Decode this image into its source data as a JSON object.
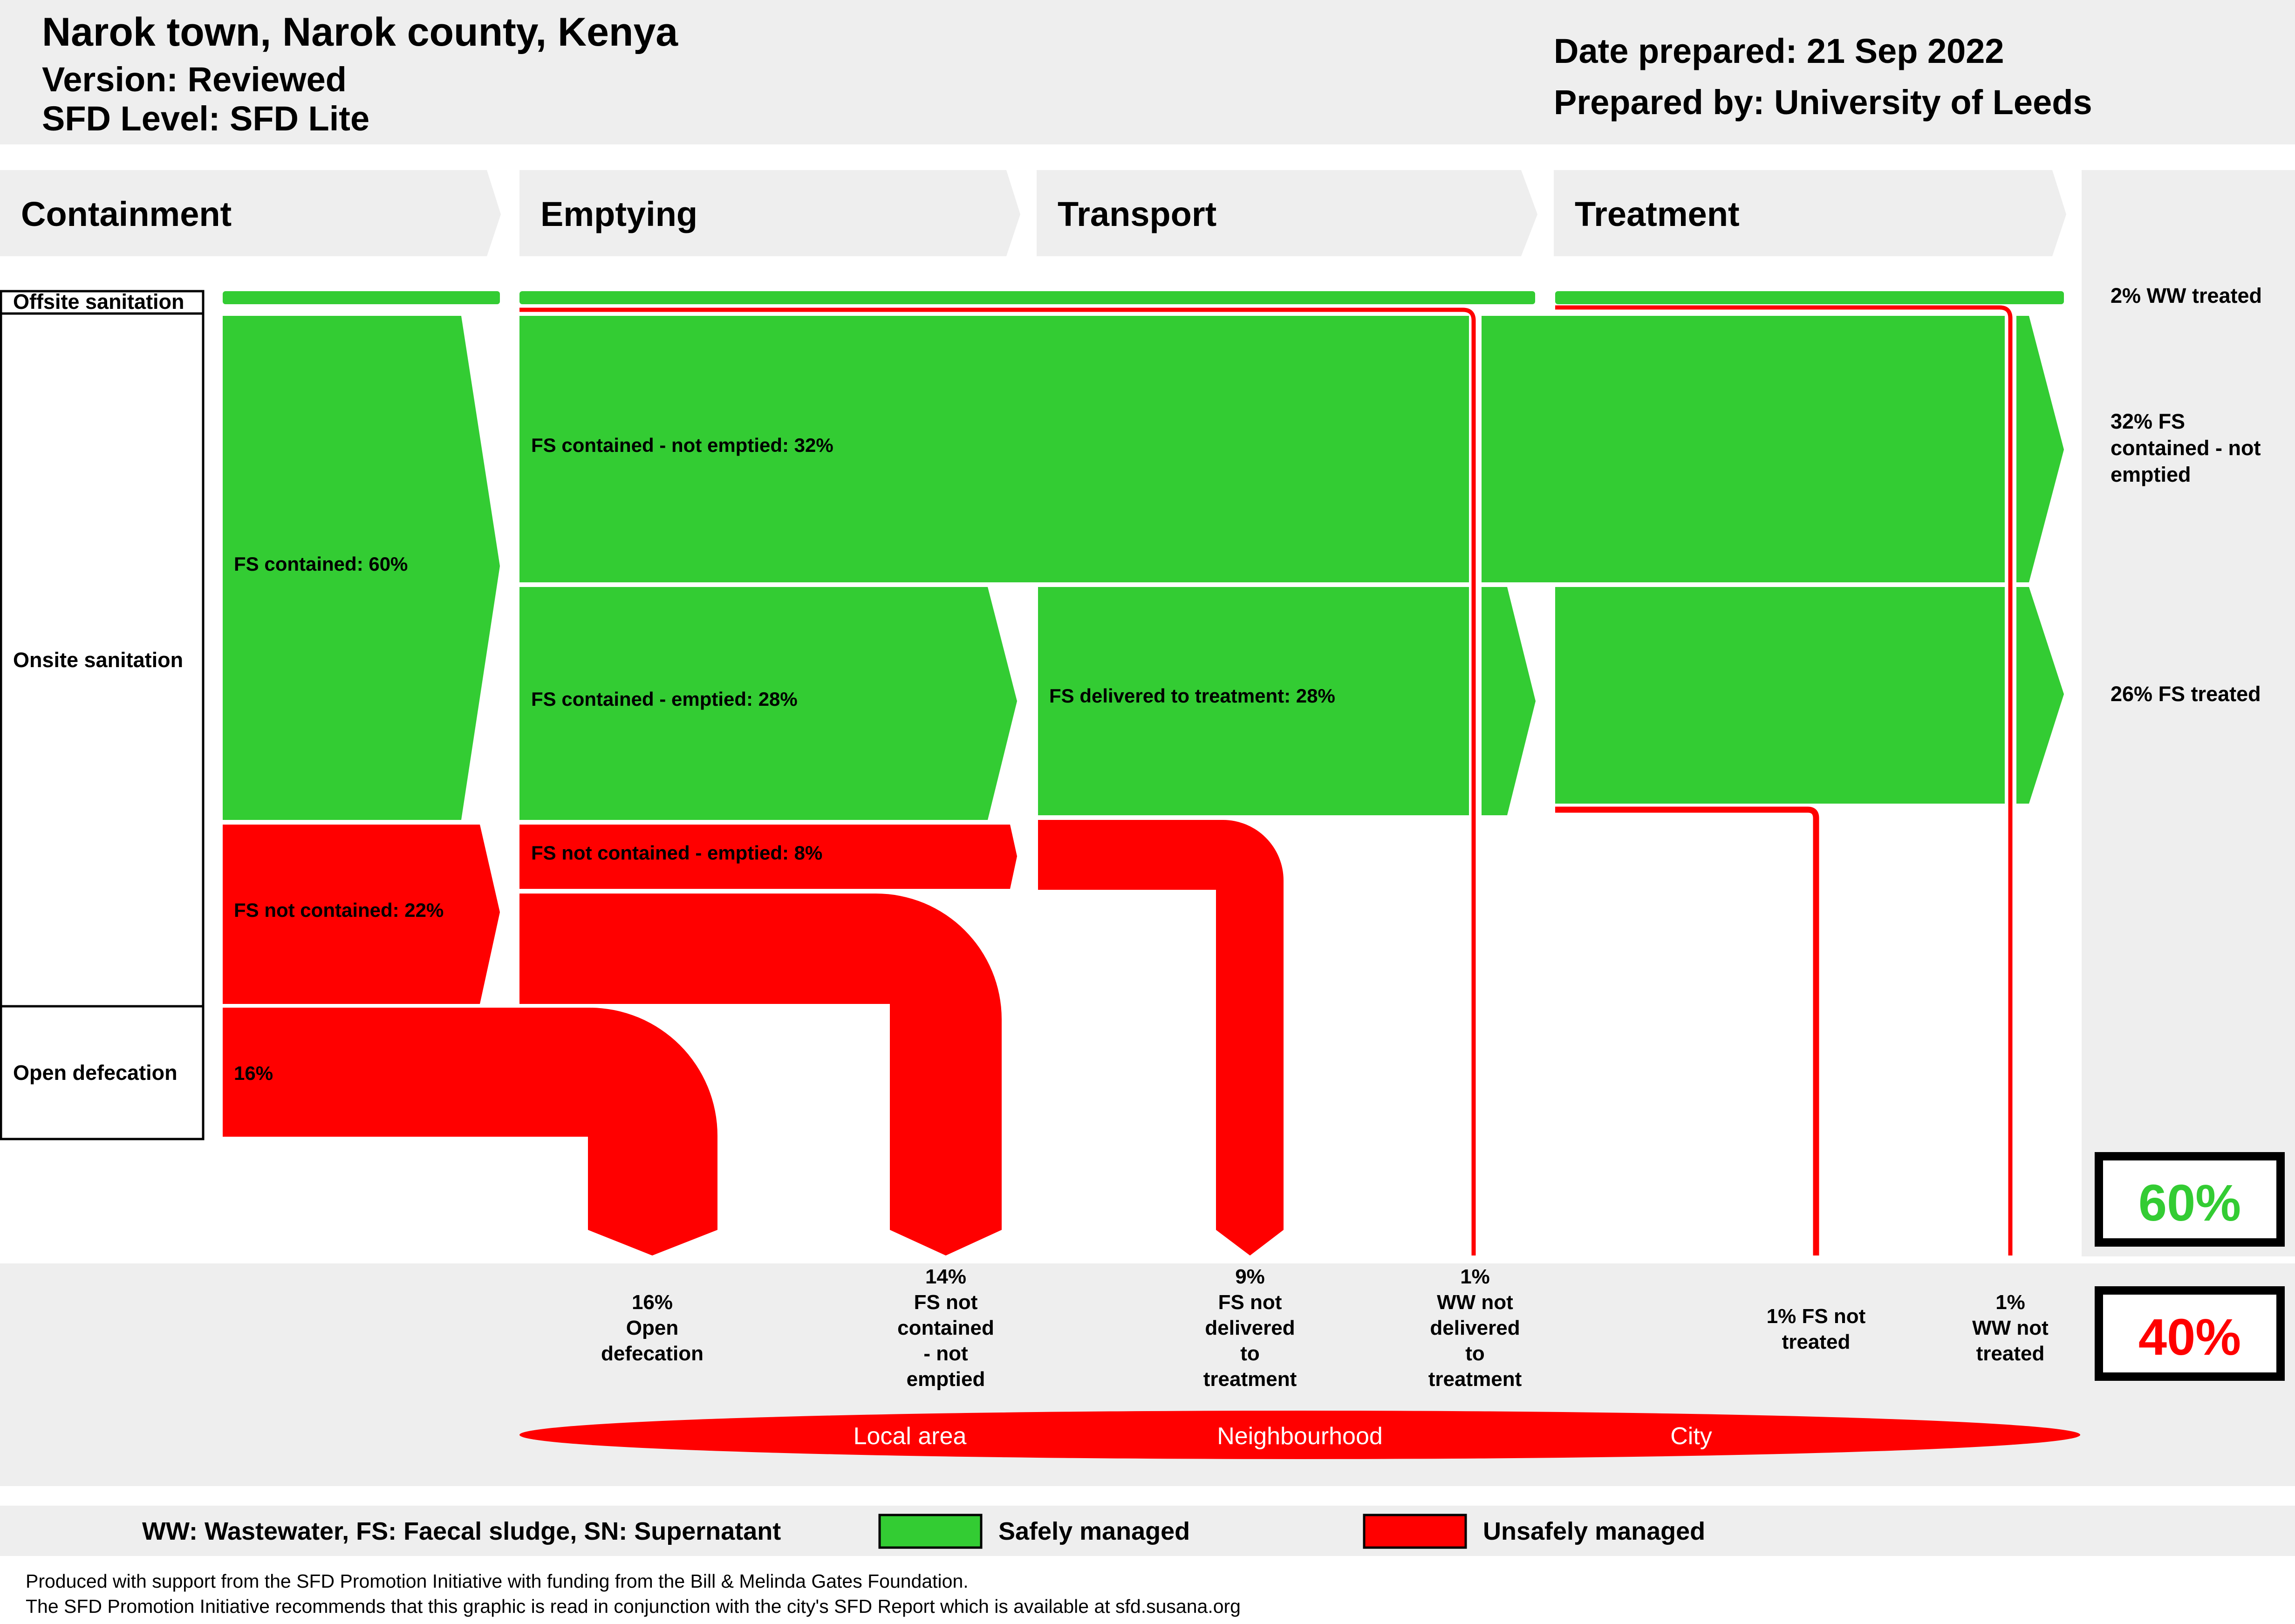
{
  "header": {
    "city": "Narok town, Narok county, Kenya",
    "version": "Version: Reviewed",
    "level": "SFD Level: SFD Lite",
    "date": "Date prepared: 21 Sep 2022",
    "prepared_by": "Prepared by: University of Leeds"
  },
  "stages": [
    "Containment",
    "Emptying",
    "Transport",
    "Treatment"
  ],
  "rows": {
    "offsite": "Offsite sanitation",
    "onsite": "Onsite sanitation",
    "open_defecation": "Open defecation"
  },
  "flows": {
    "fs_contained": "FS contained: 60%",
    "fs_not_contained": "FS not contained: 22%",
    "open_def": "16%",
    "not_emptied": "FS contained - not emptied: 32%",
    "emptied": "FS contained - emptied: 28%",
    "nc_emptied": "FS not contained - emptied: 8%",
    "delivered": "FS delivered to treatment: 28%"
  },
  "outcomes_right": {
    "ww_treated": "2% WW treated",
    "fs_not_emptied": [
      "32% FS",
      "contained - not",
      "emptied"
    ],
    "fs_treated": "26% FS treated"
  },
  "bottom_labels": {
    "od": [
      "16%",
      "Open",
      "defecation"
    ],
    "nc": [
      "14%",
      "FS not",
      "contained",
      "- not",
      "emptied"
    ],
    "fs_nd": [
      "9%",
      "FS not",
      "delivered",
      "to",
      "treatment"
    ],
    "ww_nd": [
      "1%",
      "WW not",
      "delivered",
      "to",
      "treatment"
    ],
    "fs_nt": [
      "1% FS not",
      "treated"
    ],
    "ww_nt": [
      "1%",
      "WW not",
      "treated"
    ]
  },
  "totals": {
    "safe": "60%",
    "unsafe": "40%"
  },
  "areas": [
    "Local area",
    "Neighbourhood",
    "City"
  ],
  "legend": {
    "abbrev": "WW: Wastewater, FS: Faecal sludge, SN: Supernatant",
    "safe": "Safely managed",
    "unsafe": "Unsafely managed"
  },
  "colors": {
    "safe": "#33cc33",
    "unsafe": "#ff0000",
    "panel": "#eeeeee"
  },
  "footer": {
    "line1": "Produced with support from the SFD Promotion Initiative with funding from the Bill & Melinda Gates Foundation.",
    "line2": "The SFD Promotion Initiative recommends that this graphic is read in conjunction with the city's SFD Report which is available at sfd.susana.org"
  }
}
